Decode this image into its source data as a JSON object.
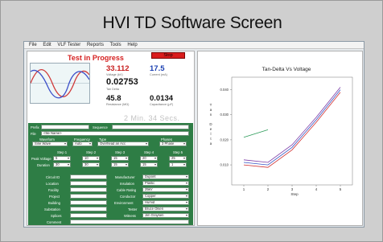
{
  "caption": "HVI TD Software Screen",
  "menu": [
    "File",
    "Edit",
    "VLF Tester",
    "Reports",
    "Tools",
    "Help"
  ],
  "status": {
    "title": "Test in Progress",
    "stop_label": "Stop"
  },
  "readings": [
    {
      "value": "33.112",
      "label": "Voltage (kV)",
      "color": "#c81f1f"
    },
    {
      "value": "17.5",
      "label": "Current (mA)",
      "color": "#1a3fb2"
    },
    {
      "value": "0.02753",
      "label": "Tan Delta",
      "color": "#111111"
    },
    {
      "value": "45.8",
      "label": "Resistance (MΩ)",
      "color": "#111111"
    },
    {
      "value": "0.0134",
      "label": "Capacitance (µF)",
      "color": "#111111"
    }
  ],
  "timer": "2 Min. 34 Secs.",
  "form": {
    "prefix_label": "Prefix",
    "prefix_value": "",
    "sequence_label": "Sequence",
    "sequence_value": "",
    "file_label": "File",
    "file_value": "<file Name>",
    "waveform_label": "Waveform",
    "waveform_value": "Sine Wave",
    "frequency_label": "Frequency",
    "frequency_value": "Auto",
    "type_label": "Type",
    "type_value": "Overhead an Acc",
    "phases_label": "Phases",
    "phases_value": "3 Phase",
    "peak_voltage_label": "Peak Voltage",
    "duration_label": "Duration",
    "steps": [
      {
        "label": "Step 1",
        "voltage": "5",
        "duration": "30"
      },
      {
        "label": "Step 2",
        "voltage": "10",
        "duration": "30"
      },
      {
        "label": "Step 3",
        "voltage": "15",
        "duration": "15"
      },
      {
        "label": "Step 4",
        "voltage": "20",
        "duration": "15"
      },
      {
        "label": "Step 5",
        "voltage": "25",
        "duration": "1"
      }
    ],
    "left_fields": [
      {
        "label": "Circuit ID",
        "value": ""
      },
      {
        "label": "Location",
        "value": ""
      },
      {
        "label": "Facility",
        "value": ""
      },
      {
        "label": "Project",
        "value": ""
      },
      {
        "label": "Building",
        "value": ""
      },
      {
        "label": "Substation",
        "value": ""
      },
      {
        "label": "Splices",
        "value": ""
      },
      {
        "label": "Comment",
        "value": ""
      }
    ],
    "right_fields": [
      {
        "label": "Manufacturer",
        "value": "Dupont"
      },
      {
        "label": "Insulation",
        "value": "Plastic"
      },
      {
        "label": "Cable Rating",
        "value": "25kV"
      },
      {
        "label": "Conductor",
        "value": "Copper"
      },
      {
        "label": "Environment",
        "value": "Humid"
      },
      {
        "label": "Tester",
        "value": "Bruce Olsen"
      },
      {
        "label": "Witness",
        "value": "Jim Graysen"
      }
    ]
  },
  "chart_data": {
    "type": "line",
    "title": "Tan-Delta Vs Voltage",
    "xlabel": "Step",
    "ylabel": "Tan Delta",
    "x": [
      1,
      2,
      3,
      4,
      5
    ],
    "xlim": [
      0.5,
      5.5
    ],
    "ylim": [
      0.002,
      0.045
    ],
    "yticks": [
      0.01,
      0.02,
      0.03,
      0.04
    ],
    "grid": false,
    "series": [
      {
        "color": "#2a9a58",
        "values": [
          0.021,
          0.024,
          null,
          null,
          null
        ]
      },
      {
        "color": "#d02f2f",
        "values": [
          0.01,
          0.009,
          0.016,
          0.027,
          0.039
        ]
      },
      {
        "color": "#3553c4",
        "values": [
          0.011,
          0.01,
          0.017,
          0.028,
          0.04
        ]
      },
      {
        "color": "#7c3aa6",
        "values": [
          0.012,
          0.011,
          0.018,
          0.029,
          0.041
        ]
      }
    ]
  }
}
